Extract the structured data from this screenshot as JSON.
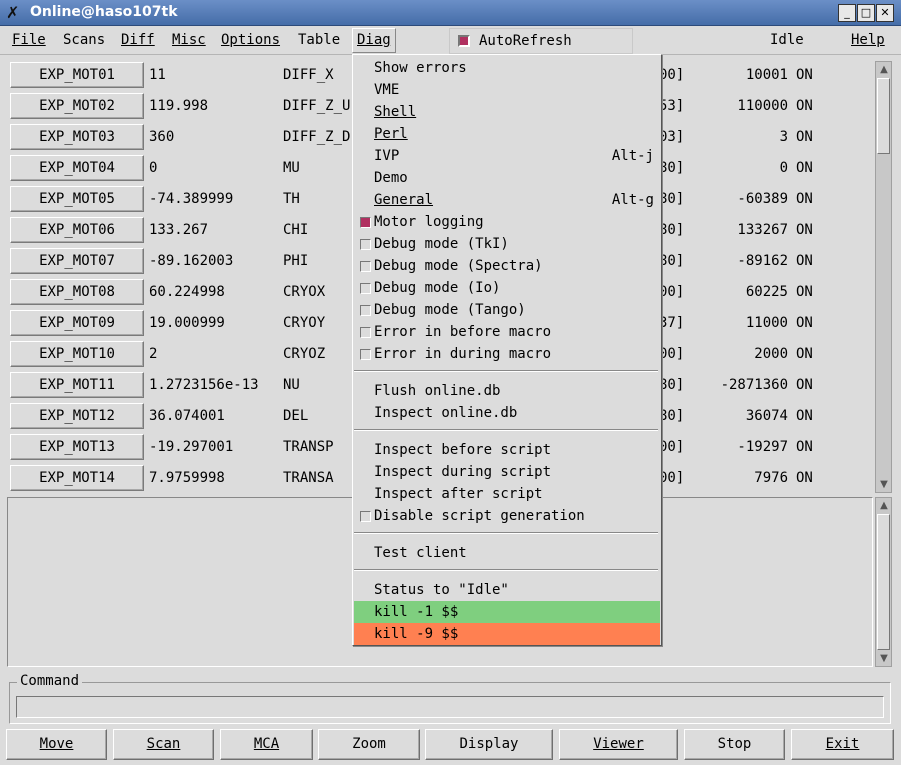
{
  "window": {
    "title": "Online@haso107tk"
  },
  "menubar": {
    "file": "File",
    "scans": "Scans",
    "diff": "Diff",
    "misc": "Misc",
    "options": "Options",
    "table": "Table",
    "diag": "Diag",
    "autorefresh": "AutoRefresh",
    "status": "Idle",
    "help": "Help"
  },
  "motors": [
    {
      "button": "EXP_MOT01",
      "value": "11",
      "name": "DIFF_X",
      "limit": "00]",
      "internal": "10001",
      "state": "ON"
    },
    {
      "button": "EXP_MOT02",
      "value": "119.998",
      "name": "DIFF_Z_U",
      "limit": "53]",
      "internal": "110000",
      "state": "ON"
    },
    {
      "button": "EXP_MOT03",
      "value": "360",
      "name": "DIFF_Z_D",
      "limit": "03]",
      "internal": "3",
      "state": "ON"
    },
    {
      "button": "EXP_MOT04",
      "value": "0",
      "name": "MU",
      "limit": "80]",
      "internal": "0",
      "state": "ON"
    },
    {
      "button": "EXP_MOT05",
      "value": "-74.389999",
      "name": "TH",
      "limit": "80]",
      "internal": "-60389",
      "state": "ON"
    },
    {
      "button": "EXP_MOT06",
      "value": "133.267",
      "name": "CHI",
      "limit": "80]",
      "internal": "133267",
      "state": "ON"
    },
    {
      "button": "EXP_MOT07",
      "value": "-89.162003",
      "name": "PHI",
      "limit": "80]",
      "internal": "-89162",
      "state": "ON"
    },
    {
      "button": "EXP_MOT08",
      "value": "60.224998",
      "name": "CRYOX",
      "limit": "00]",
      "internal": "60225",
      "state": "ON"
    },
    {
      "button": "EXP_MOT09",
      "value": "19.000999",
      "name": "CRYOY",
      "limit": "37]",
      "internal": "11000",
      "state": "ON"
    },
    {
      "button": "EXP_MOT10",
      "value": "2",
      "name": "CRYOZ",
      "limit": "00]",
      "internal": "2000",
      "state": "ON"
    },
    {
      "button": "EXP_MOT11",
      "value": "1.2723156e-13",
      "name": "NU",
      "limit": "80]",
      "internal": "-2871360",
      "state": "ON"
    },
    {
      "button": "EXP_MOT12",
      "value": "36.074001",
      "name": "DEL",
      "limit": "80]",
      "internal": "36074",
      "state": "ON"
    },
    {
      "button": "EXP_MOT13",
      "value": "-19.297001",
      "name": "TRANSP",
      "limit": "00]",
      "internal": "-19297",
      "state": "ON"
    },
    {
      "button": "EXP_MOT14",
      "value": "7.9759998",
      "name": "TRANSA",
      "limit": "00]",
      "internal": "7976",
      "state": "ON"
    }
  ],
  "diag_menu": {
    "show_errors": "Show errors",
    "vme": "VME",
    "shell": "Shell",
    "perl": "Perl",
    "ivp": "IVP",
    "ivp_accel": "Alt-j",
    "demo": "Demo",
    "general": "General",
    "general_accel": "Alt-g",
    "motor_logging": "Motor logging",
    "debug_tki": "Debug mode (TkI)",
    "debug_spectra": "Debug mode (Spectra)",
    "debug_io": "Debug mode (Io)",
    "debug_tango": "Debug mode (Tango)",
    "error_before": "Error in before macro",
    "error_during": "Error in during macro",
    "flush_db": "Flush online.db",
    "inspect_db": "Inspect online.db",
    "inspect_before": "Inspect before script",
    "inspect_during": "Inspect during script",
    "inspect_after": "Inspect after script",
    "disable_script": "Disable script generation",
    "test_client": "Test client",
    "status_idle": "Status to \"Idle\"",
    "kill1": "kill -1 $$",
    "kill9": "kill -9 $$"
  },
  "command": {
    "label": "Command",
    "value": ""
  },
  "buttons": {
    "move": "Move",
    "scan": "Scan",
    "mca": "MCA",
    "zoom": "Zoom",
    "display": "Display",
    "viewer": "Viewer",
    "stop": "Stop",
    "exit": "Exit"
  },
  "colors": {
    "kill1_bg": "#7fcf7f",
    "kill9_bg": "#ff8051",
    "check_on": "#b03060",
    "titlebar": "#5680bb"
  }
}
